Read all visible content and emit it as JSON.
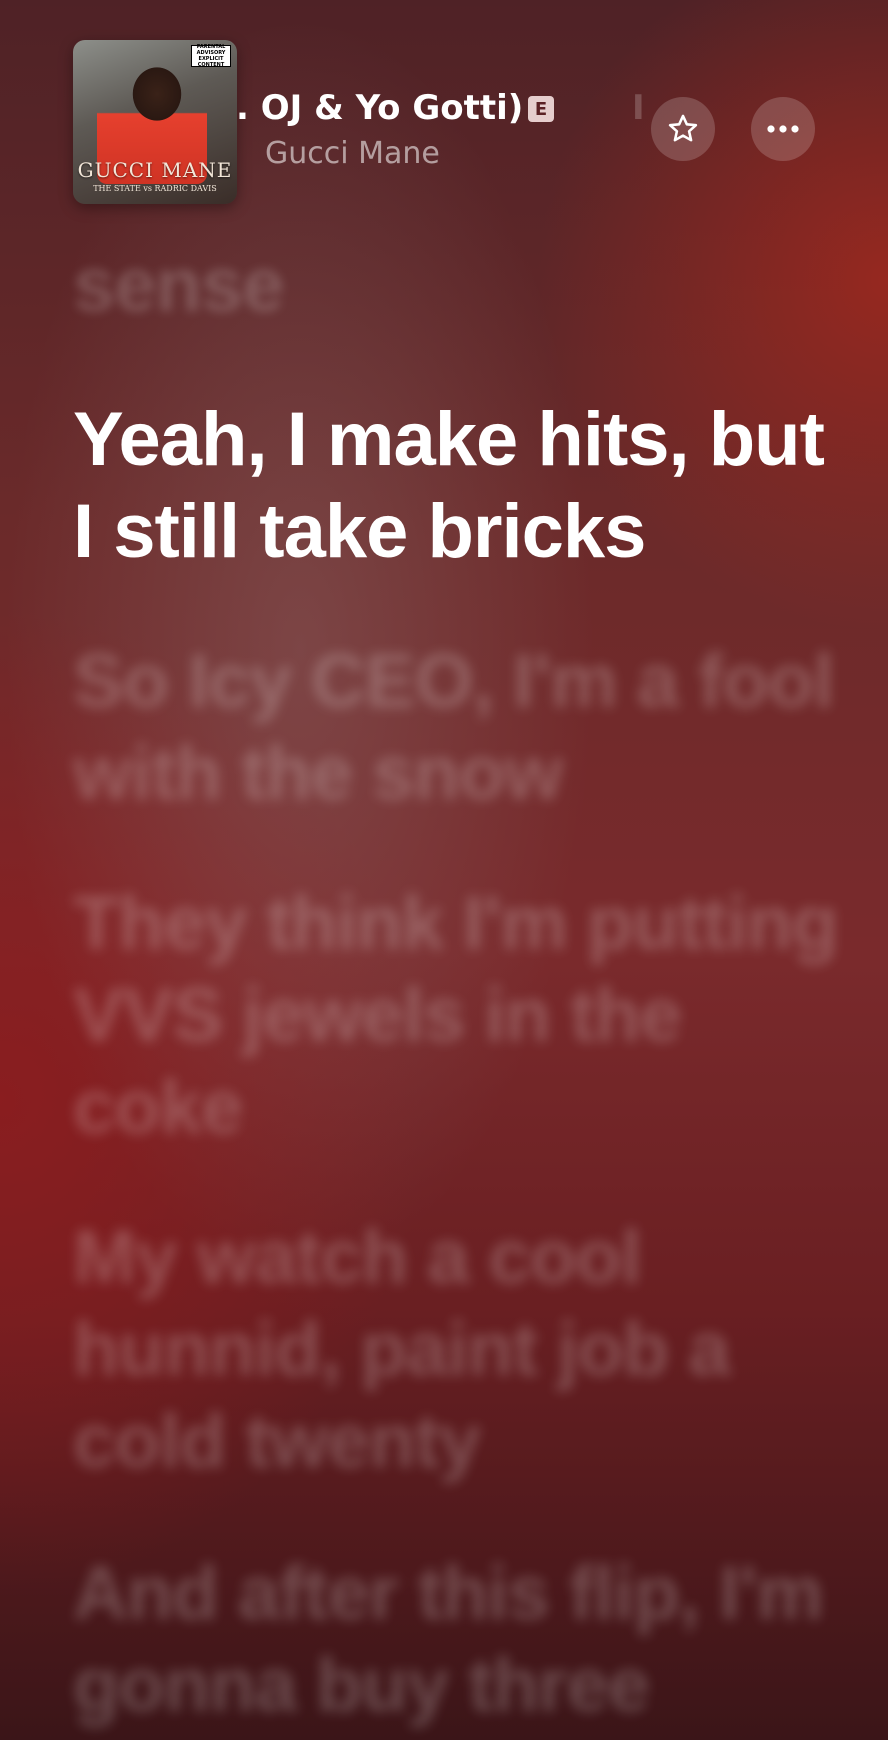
{
  "header": {
    "album": {
      "artist_text": "GUCCI MANE",
      "album_subtitle": "THE STATE vs RADRIC DAVIS",
      "advisory": "PARENTAL ADVISORY EXPLICIT CONTENT"
    },
    "song_title_visible": ". OJ & Yo Gotti)",
    "explicit_badge": "E",
    "scroll_fade_text": "I",
    "artist": "Gucci Mane",
    "favorite_icon": "star-outline-icon",
    "more_icon": "ellipsis-icon"
  },
  "lyrics": {
    "previous_line": "sense",
    "current_line": "Yeah, I make hits, but I still take bricks",
    "upcoming_lines": [
      "So Icy CEO, I'm a fool with the snow",
      "They think I'm putting VVS jewels in the coke",
      "My watch a cool hunnid, paint job a cold twenty",
      "And after this flip, I'm gonna buy three"
    ]
  },
  "colors": {
    "background": "#6b2a2a",
    "accent_red": "#a0281e",
    "text_primary": "#ffffff"
  }
}
